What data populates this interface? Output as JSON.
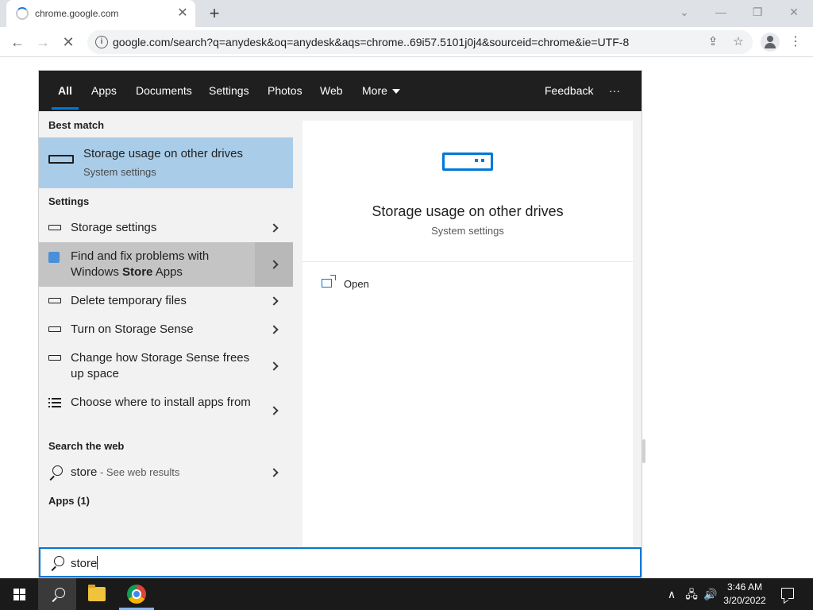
{
  "browser": {
    "tab_title": "chrome.google.com",
    "tab_close": "✕",
    "new_tab": "+",
    "window_controls": {
      "dropdown": "⌄",
      "minimize": "—",
      "restore": "❐",
      "close": "✕"
    },
    "nav": {
      "back": "←",
      "forward": "→",
      "stop": "✕"
    },
    "url": "google.com/search?q=anydesk&oq=anydesk&aqs=chrome..69i57.5101j0j4&sourceid=chrome&ie=UTF-8",
    "icons": [
      "info-icon",
      "share-icon",
      "star-icon",
      "profile-icon",
      "menu-icon"
    ]
  },
  "search_panel": {
    "filters": [
      "All",
      "Apps",
      "Documents",
      "Settings",
      "Photos",
      "Web",
      "More"
    ],
    "active_filter": "All",
    "feedback": "Feedback",
    "overflow": "···",
    "best_match_header": "Best match",
    "best_match": {
      "title": "Storage usage on other drives",
      "subtitle": "System settings"
    },
    "settings_header": "Settings",
    "settings_items": [
      {
        "label": "Storage settings"
      },
      {
        "label_prefix": "Find and fix problems with Windows ",
        "label_bold": "Store",
        "label_suffix": " Apps"
      },
      {
        "label": "Delete temporary files"
      },
      {
        "label": "Turn on Storage Sense"
      },
      {
        "label": "Change how Storage Sense frees up space"
      },
      {
        "label": "Choose where to install apps from"
      }
    ],
    "web_header": "Search the web",
    "web_item": {
      "query": "store",
      "suffix": " - See web results"
    },
    "apps_header": "Apps (1)",
    "preview": {
      "title": "Storage usage on other drives",
      "subtitle": "System settings",
      "action": "Open"
    },
    "query": "store"
  },
  "taskbar": {
    "time": "3:46 AM",
    "date": "3/20/2022",
    "tray": {
      "chevron": "∧",
      "network": "🖧",
      "volume": "🔊"
    },
    "icons": [
      "windows-start-icon",
      "search-icon",
      "file-explorer-icon",
      "chrome-icon",
      "notification-icon"
    ]
  }
}
